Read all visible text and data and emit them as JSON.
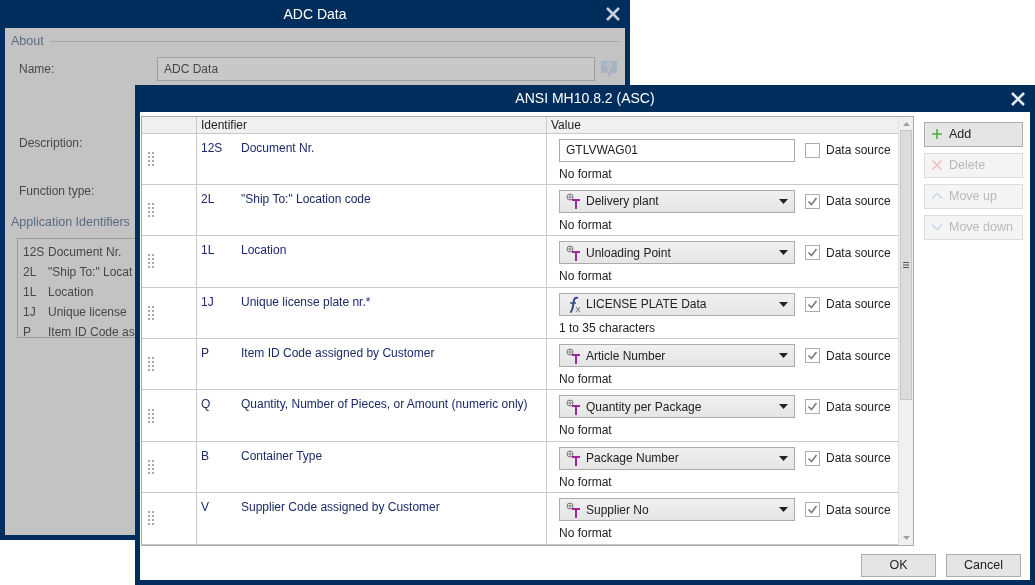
{
  "background_window": {
    "title": "ADC Data",
    "section": "About",
    "fields": [
      {
        "label": "Name:",
        "value": "ADC Data"
      },
      {
        "label": "Description:"
      },
      {
        "label": "Function type:"
      }
    ],
    "list_title": "Application Identifiers",
    "list_items": [
      {
        "code": "12S",
        "text": "Document Nr."
      },
      {
        "code": "2L",
        "text": "\"Ship To:\" Locat"
      },
      {
        "code": "1L",
        "text": "Location"
      },
      {
        "code": "1J",
        "text": "Unique license"
      },
      {
        "code": "P",
        "text": "Item ID Code as"
      }
    ]
  },
  "dialog": {
    "title": "ANSI MH10.8.2 (ASC)",
    "columns": [
      "Identifier",
      "Value"
    ],
    "rows": [
      {
        "code": "12S",
        "name": "Document Nr.",
        "value": {
          "kind": "text",
          "text": "GTLVWAG01"
        },
        "data_source": false,
        "data_source_label": "Data source",
        "format": "No format"
      },
      {
        "code": "2L",
        "name": "\"Ship To:\" Location code",
        "value": {
          "kind": "variable",
          "text": "Delivery plant"
        },
        "data_source": true,
        "data_source_label": "Data source",
        "format": "No format"
      },
      {
        "code": "1L",
        "name": "Location",
        "value": {
          "kind": "variable",
          "text": "Unloading Point"
        },
        "data_source": true,
        "data_source_label": "Data source",
        "format": "No format"
      },
      {
        "code": "1J",
        "name": "Unique license plate nr.*",
        "value": {
          "kind": "function",
          "text": "LICENSE PLATE Data"
        },
        "data_source": true,
        "data_source_label": "Data source",
        "format": "1 to 35 characters"
      },
      {
        "code": "P",
        "name": "Item ID Code assigned by Customer",
        "value": {
          "kind": "variable",
          "text": "Article Number"
        },
        "data_source": true,
        "data_source_label": "Data source",
        "format": "No format"
      },
      {
        "code": "Q",
        "name": "Quantity, Number of Pieces, or Amount (numeric only)",
        "value": {
          "kind": "variable",
          "text": "Quantity per Package"
        },
        "data_source": true,
        "data_source_label": "Data source",
        "format": "No format"
      },
      {
        "code": "B",
        "name": "Container Type",
        "value": {
          "kind": "variable",
          "text": "Package Number"
        },
        "data_source": true,
        "data_source_label": "Data source",
        "format": "No format"
      },
      {
        "code": "V",
        "name": "Supplier Code assigned by Customer",
        "value": {
          "kind": "variable",
          "text": "Supplier No"
        },
        "data_source": true,
        "data_source_label": "Data source",
        "format": "No format"
      }
    ],
    "side_buttons": [
      {
        "label": "Add",
        "disabled": false
      },
      {
        "label": "Delete",
        "disabled": true
      },
      {
        "label": "Move up",
        "disabled": true
      },
      {
        "label": "Move down",
        "disabled": true
      }
    ],
    "footer_buttons": [
      "OK",
      "Cancel"
    ]
  }
}
